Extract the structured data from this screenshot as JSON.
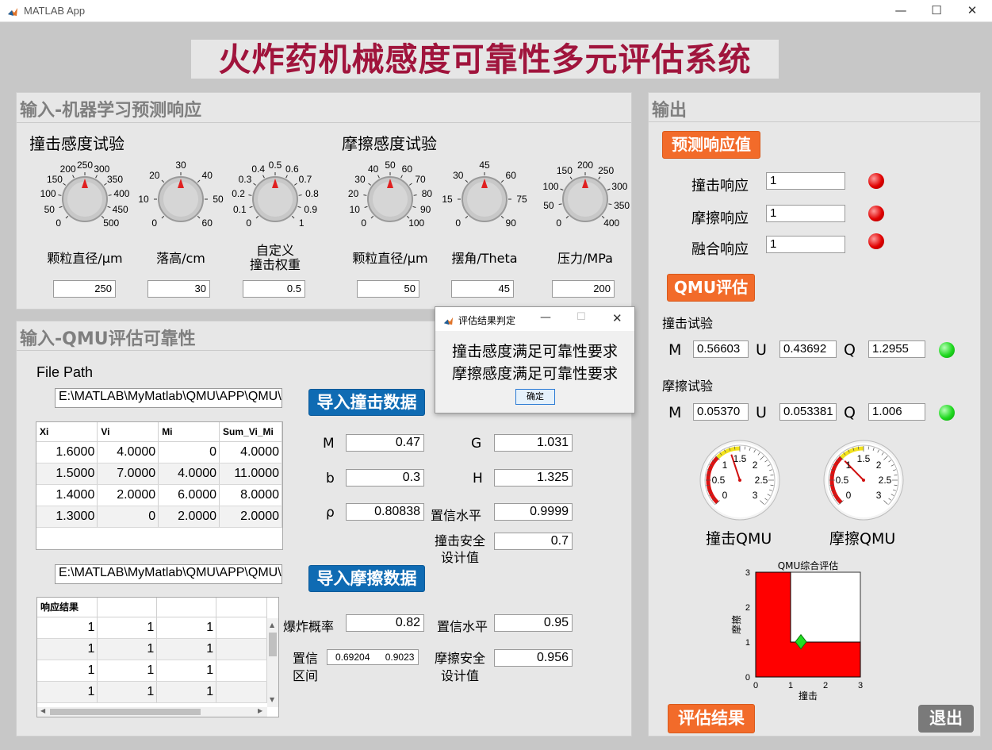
{
  "window": {
    "title": "MATLAB App",
    "minimize": "—",
    "maximize": "☐",
    "close": "✕"
  },
  "main_title": "火炸药机械感度可靠性多元评估系统",
  "ml_panel": {
    "title": "输入-机器学习预测响应",
    "impact_title": "撞击感度试验",
    "friction_title": "摩擦感度试验",
    "knobs": [
      {
        "label": "颗粒直径/μm",
        "value": "250",
        "ticks": [
          "0",
          "50",
          "100",
          "150",
          "200",
          "250",
          "300",
          "350",
          "400",
          "450",
          "500"
        ],
        "level": 0.5
      },
      {
        "label": "落高/cm",
        "value": "30",
        "ticks": [
          "0",
          "10",
          "20",
          "30",
          "40",
          "50",
          "60"
        ],
        "level": 0.5
      },
      {
        "label": "自定义\n撞击权重",
        "value": "0.5",
        "ticks": [
          "0",
          "0.1",
          "0.2",
          "0.3",
          "0.4",
          "0.5",
          "0.6",
          "0.7",
          "0.8",
          "0.9",
          "1"
        ],
        "level": 0.5
      },
      {
        "label": "颗粒直径/μm",
        "value": "50",
        "ticks": [
          "0",
          "10",
          "20",
          "30",
          "40",
          "50",
          "60",
          "70",
          "80",
          "90",
          "100"
        ],
        "level": 0.5
      },
      {
        "label": "摆角/Theta",
        "value": "45",
        "ticks": [
          "0",
          "15",
          "30",
          "45",
          "60",
          "75",
          "90"
        ],
        "level": 0.5
      },
      {
        "label": "压力/MPa",
        "value": "200",
        "ticks": [
          "0",
          "50",
          "100",
          "150",
          "200",
          "250",
          "300",
          "350",
          "400"
        ],
        "level": 0.5
      }
    ]
  },
  "qmu_panel": {
    "title": "输入-QMU评估可靠性",
    "file_path_label": "File Path",
    "impact_path": "E:\\MATLAB\\MyMatlab\\QMU\\APP\\QMU\\",
    "friction_path": "E:\\MATLAB\\MyMatlab\\QMU\\APP\\QMU\\",
    "import_impact": "导入撞击数据",
    "import_friction": "导入摩擦数据",
    "impact_table": {
      "headers": [
        "Xi",
        "Vi",
        "Mi",
        "Sum_Vi_Mi"
      ],
      "rows": [
        [
          "1.6000",
          "4.0000",
          "0",
          "4.0000"
        ],
        [
          "1.5000",
          "7.0000",
          "4.0000",
          "11.0000"
        ],
        [
          "1.4000",
          "2.0000",
          "6.0000",
          "8.0000"
        ],
        [
          "1.3000",
          "0",
          "2.0000",
          "2.0000"
        ]
      ]
    },
    "friction_table": {
      "headers": [
        "响应结果",
        "",
        "",
        ""
      ],
      "rows": [
        [
          "1",
          "1",
          "1",
          ""
        ],
        [
          "1",
          "1",
          "1",
          ""
        ],
        [
          "1",
          "1",
          "1",
          ""
        ],
        [
          "1",
          "1",
          "1",
          ""
        ]
      ]
    },
    "params": {
      "M_label": "M",
      "M": "0.47",
      "b_label": "b",
      "b": "0.3",
      "rho_label": "ρ",
      "rho": "0.80838",
      "G_label": "G",
      "G": "1.031",
      "H_label": "H",
      "H": "1.325",
      "conf1_label": "置信水平",
      "conf1": "0.9999",
      "impact_safe_label": "撞击安全\n设计值",
      "impact_safe": "0.7",
      "burst_label": "爆炸概率",
      "burst": "0.82",
      "conf2_label": "置信水平",
      "conf2": "0.95",
      "interval_label": "置信\n区间",
      "interval_low": "0.69204",
      "interval_high": "0.9023",
      "friction_safe_label": "摩擦安全\n设计值",
      "friction_safe": "0.956"
    }
  },
  "dialog": {
    "title": "评估结果判定",
    "line1": "撞击感度满足可靠性要求",
    "line2": "摩擦感度满足可靠性要求",
    "ok": "确定"
  },
  "output_panel": {
    "title": "输出",
    "predict_button": "预测响应值",
    "impact_resp_label": "撞击响应",
    "impact_resp": "1",
    "friction_resp_label": "摩擦响应",
    "friction_resp": "1",
    "fusion_resp_label": "融合响应",
    "fusion_resp": "1",
    "qmu_button": "QMU评估",
    "impact_test_label": "撞击试验",
    "friction_test_label": "摩擦试验",
    "M_label": "M",
    "U_label": "U",
    "Q_label": "Q",
    "impact_M": "0.56603",
    "impact_U": "0.43692",
    "impact_Q": "1.2955",
    "friction_M": "0.05370",
    "friction_U": "0.053381",
    "friction_Q": "1.006",
    "gauge_ticks": [
      "0",
      "0.5",
      "1",
      "1.5",
      "2",
      "2.5",
      "3"
    ],
    "impact_gauge_label": "撞击QMU",
    "friction_gauge_label": "摩擦QMU",
    "impact_gauge_value": 1.2955,
    "friction_gauge_value": 1.006,
    "eval_button": "评估结果",
    "exit_button": "退出",
    "colors": {
      "accent_orange": "#f26b2a",
      "blue": "#0f6bb3",
      "red": "#ff0000",
      "green": "#22dd22"
    }
  },
  "chart_data": {
    "type": "area",
    "title": "QMU综合评估",
    "xlabel": "撞击",
    "ylabel": "摩擦",
    "xlim": [
      0,
      3
    ],
    "ylim": [
      0,
      3
    ],
    "xticks": [
      "0",
      "1",
      "2",
      "3"
    ],
    "yticks": [
      "0",
      "1",
      "2",
      "3"
    ],
    "region_polygon": [
      [
        0,
        0
      ],
      [
        3,
        0
      ],
      [
        3,
        1
      ],
      [
        1,
        1
      ],
      [
        1,
        3
      ],
      [
        0,
        3
      ]
    ],
    "marker": {
      "x": 1.2955,
      "y": 1.006
    }
  }
}
